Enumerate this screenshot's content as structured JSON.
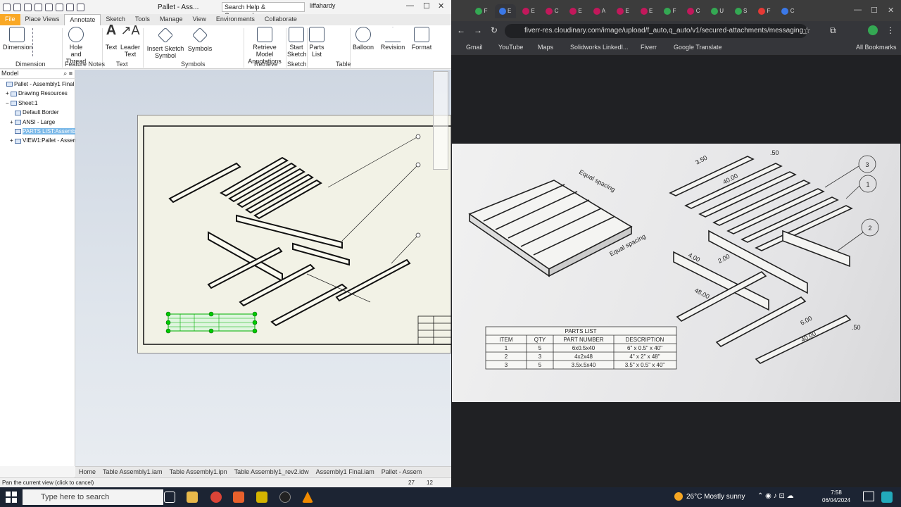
{
  "inventor": {
    "doc_title": "Pallet - Ass...",
    "search_placeholder": "Search Help & Commands...",
    "user": "liffahardy",
    "ribbon_tabs": [
      "File",
      "Place Views",
      "Annotate",
      "Sketch",
      "Tools",
      "Manage",
      "View",
      "Environments",
      "Collaborate"
    ],
    "active_tab": "Annotate",
    "tools": {
      "dimension": "Dimension",
      "hole_thread": "Hole and Thread",
      "text": "Text",
      "leader_text": "Leader Text",
      "insert_sketch_symbol": "Insert Sketch Symbol",
      "symbols": "Symbols",
      "retrieve_model_annotations": "Retrieve Model Annotations",
      "start_sketch": "Start Sketch",
      "parts_list": "Parts List",
      "balloon": "Balloon",
      "revision": "Revision",
      "format": "Format"
    },
    "groups": [
      "Dimension",
      "Feature Notes",
      "Text",
      "Symbols",
      "Retrieve",
      "Sketch",
      "Table"
    ],
    "browser_header": "Model",
    "tree": [
      {
        "label": "Pallet - Assembly1 Final",
        "indent": 0,
        "twist": ""
      },
      {
        "label": "Drawing Resources",
        "indent": 1,
        "twist": "+"
      },
      {
        "label": "Sheet:1",
        "indent": 1,
        "twist": "−"
      },
      {
        "label": "Default Border",
        "indent": 2,
        "twist": ""
      },
      {
        "label": "ANSI - Large",
        "indent": 2,
        "twist": "+"
      },
      {
        "label": "PARTS LIST:Assembly",
        "indent": 2,
        "twist": ""
      },
      {
        "label": "VIEW1:Pallet - Assem",
        "indent": 2,
        "twist": "+"
      }
    ],
    "doc_tabs": [
      "Home",
      "Table Assembly1.iam",
      "Table Assembly1.ipn",
      "Table Assembly1_rev2.idw",
      "Assembly1 Final.iam",
      "Pallet - Assem"
    ],
    "status_text": "Pan the current view (click to cancel)",
    "status_nums": [
      "27",
      "12"
    ]
  },
  "browser": {
    "tab_labels": [
      "F",
      "E",
      "E",
      "C",
      "E",
      "A",
      "E",
      "E",
      "F",
      "C",
      "U",
      "S",
      "F",
      "C"
    ],
    "url": "fiverr-res.cloudinary.com/image/upload/f_auto,q_auto/v1/secured-attachments/messaging_m...",
    "bookmarks": [
      "Gmail",
      "YouTube",
      "Maps",
      "Solidworks LinkedI...",
      "Fiverr",
      "Google Translate"
    ],
    "all_bookmarks": "All Bookmarks"
  },
  "photo": {
    "parts_list_title": "PARTS LIST",
    "headers": [
      "ITEM",
      "QTY",
      "PART NUMBER",
      "DESCRIPTION"
    ],
    "rows": [
      [
        "1",
        "5",
        "6x0.5x40",
        "6\" x 0.5\" x 40\""
      ],
      [
        "2",
        "3",
        "4x2x48",
        "4\" x 2\" x 48\""
      ],
      [
        "3",
        "5",
        "3.5x.5x40",
        "3.5\" x 0.5\" x 40\""
      ]
    ],
    "annotations": {
      "equal_spacing": "Equal spacing",
      "d350": "3.50",
      "d50": ".50",
      "d4000": "40.00",
      "d400": "4.00",
      "d200": "2.00",
      "d4800": "48.00",
      "d600": "6.00",
      "d4000b": "40.00",
      "d50b": ".50"
    },
    "balloons": [
      "3",
      "1",
      "2"
    ]
  },
  "taskbar": {
    "search_placeholder": "Type here to search",
    "weather": "26°C  Mostly sunny",
    "time": "7:58",
    "date": "06/04/2024"
  },
  "colors": {
    "accent_file": "#f9a825",
    "selection": "#00cc00",
    "chrome_bg": "#202124"
  }
}
